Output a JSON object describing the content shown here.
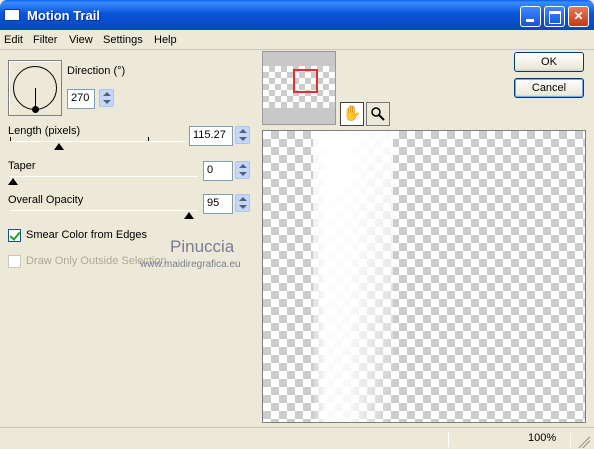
{
  "window": {
    "title": "Motion Trail"
  },
  "menu": [
    "Edit",
    "Filter",
    "View",
    "Settings",
    "Help"
  ],
  "direction": {
    "label": "Direction (°)",
    "value": "270"
  },
  "length": {
    "label": "Length (pixels)",
    "value": "115.27"
  },
  "taper": {
    "label": "Taper",
    "value": "0"
  },
  "opacity": {
    "label": "Overall Opacity",
    "value": "95"
  },
  "smear": {
    "label": "Smear Color from Edges",
    "checked": true
  },
  "draw_only": {
    "label": "Draw Only Outside Selection",
    "checked": false,
    "disabled": true
  },
  "watermark": {
    "name": "Pinuccia",
    "url": "www.maidiregrafica.eu"
  },
  "buttons": {
    "ok": "OK",
    "cancel": "Cancel"
  },
  "tools": {
    "pan": "pan-hand-icon",
    "zoom": "magnifier-icon"
  },
  "status": {
    "zoom": "100%"
  }
}
